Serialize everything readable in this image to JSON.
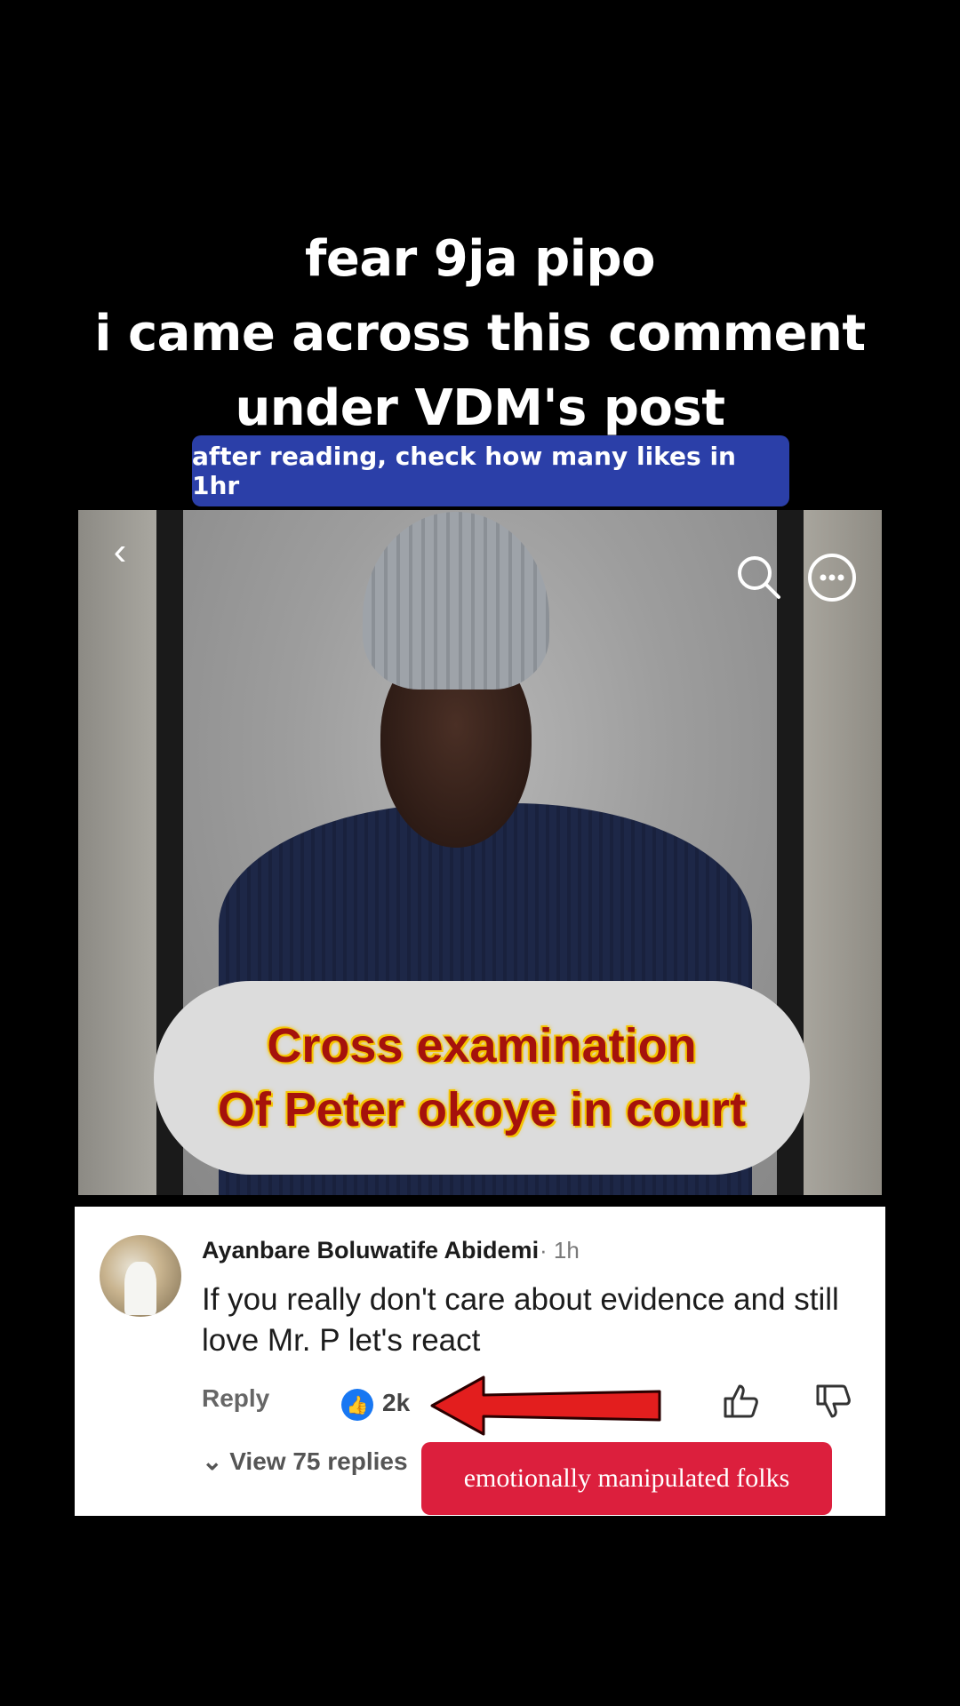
{
  "overlay": {
    "title_lines": [
      "fear 9ja pipo",
      "i came across this comment",
      "under VDM's post"
    ],
    "sticker_text": "after reading, check how many likes in 1hr"
  },
  "photo": {
    "nav_back_icon": "chevron-left-icon",
    "search_icon": "search-icon",
    "more_icon": "more-options-icon",
    "caption_lines": [
      "Cross examination",
      "Of Peter okoye in court"
    ],
    "caption_color": "#a5120c",
    "caption_glow": "#f5c400"
  },
  "comment": {
    "author": "Ayanbare Boluwatife Abidemi",
    "time": "· 1h",
    "text": "If you really don't care about evidence and still love Mr. P let's react",
    "reply_label": "Reply",
    "like_count": "2k",
    "like_color": "#1877f2",
    "view_replies": "View 75 replies",
    "annotation": "emotionally manipulated folks",
    "annotation_color": "#dc1f3d"
  }
}
